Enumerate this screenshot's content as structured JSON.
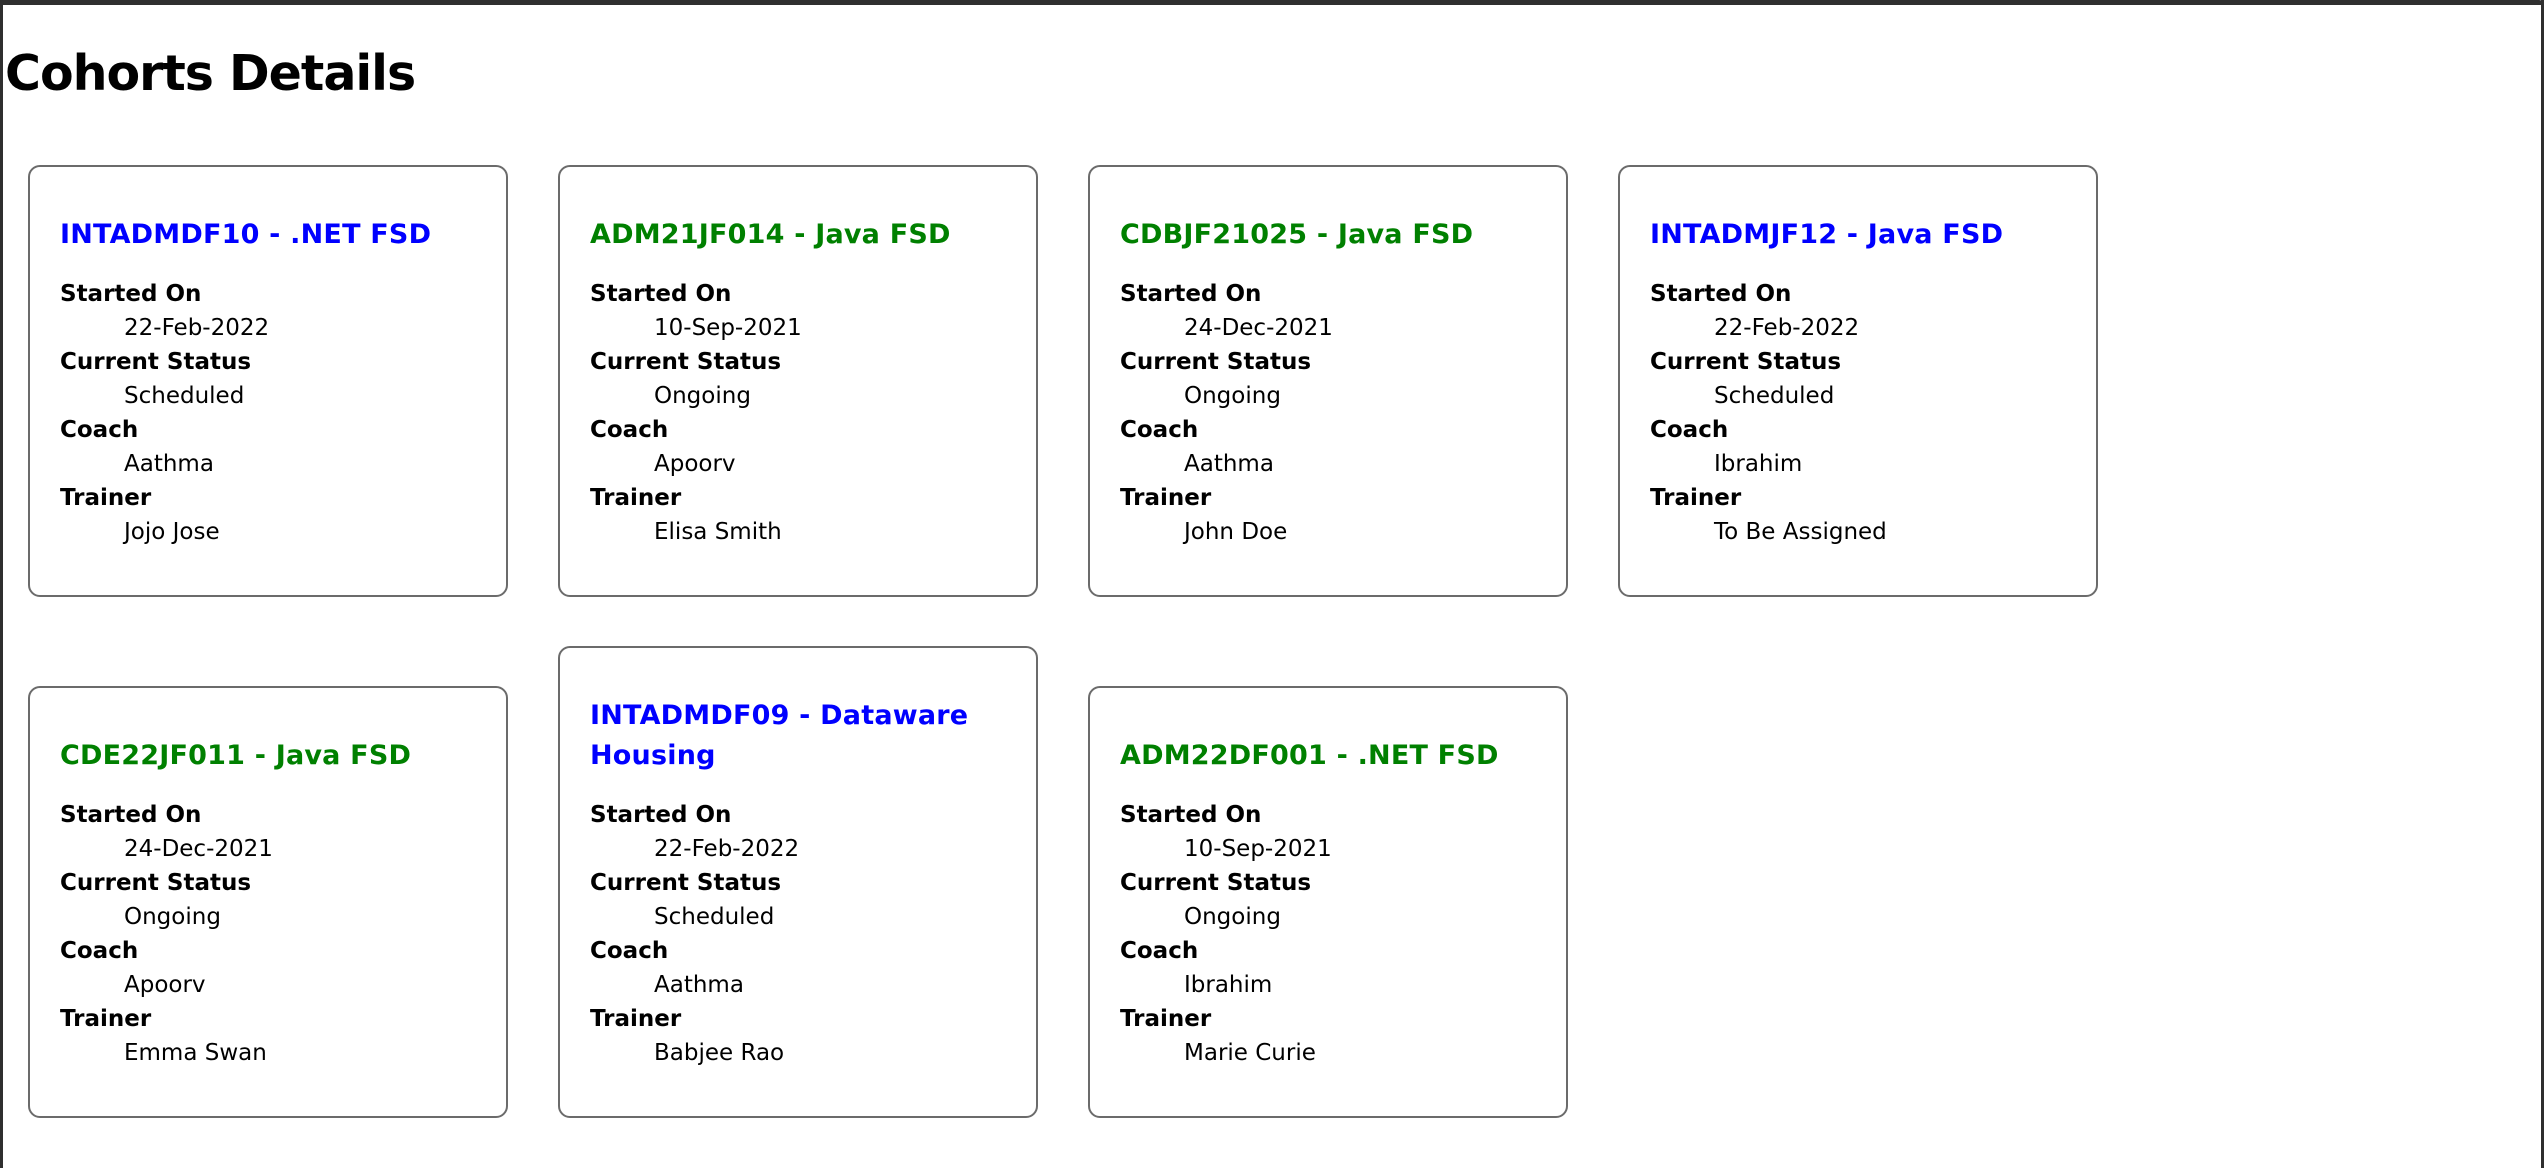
{
  "page": {
    "title": "Cohorts Details"
  },
  "colors": {
    "ongoing_title": "#008000",
    "scheduled_title": "#0000ff",
    "card_border": "#6b6b6b",
    "window_frame": "#2f2f2f"
  },
  "labels": {
    "started_on": "Started On",
    "current_status": "Current Status",
    "coach": "Coach",
    "trainer": "Trainer"
  },
  "cohorts": [
    {
      "title": "INTADMDF10 - .NET FSD",
      "started_on": "22-Feb-2022",
      "current_status": "Scheduled",
      "coach": "Aathma",
      "trainer": "Jojo Jose",
      "title_color": "blue"
    },
    {
      "title": "ADM21JF014 - Java FSD",
      "started_on": "10-Sep-2021",
      "current_status": "Ongoing",
      "coach": "Apoorv",
      "trainer": "Elisa Smith",
      "title_color": "green"
    },
    {
      "title": "CDBJF21025 - Java FSD",
      "started_on": "24-Dec-2021",
      "current_status": "Ongoing",
      "coach": "Aathma",
      "trainer": "John Doe",
      "title_color": "green"
    },
    {
      "title": "INTADMJF12 - Java FSD",
      "started_on": "22-Feb-2022",
      "current_status": "Scheduled",
      "coach": "Ibrahim",
      "trainer": "To Be Assigned",
      "title_color": "blue"
    },
    {
      "title": "CDE22JF011 - Java FSD",
      "started_on": "24-Dec-2021",
      "current_status": "Ongoing",
      "coach": "Apoorv",
      "trainer": "Emma Swan",
      "title_color": "green"
    },
    {
      "title": "INTADMDF09 - Dataware Housing",
      "started_on": "22-Feb-2022",
      "current_status": "Scheduled",
      "coach": "Aathma",
      "trainer": "Babjee Rao",
      "title_color": "blue"
    },
    {
      "title": "ADM22DF001 - .NET FSD",
      "started_on": "10-Sep-2021",
      "current_status": "Ongoing",
      "coach": "Ibrahim",
      "trainer": "Marie Curie",
      "title_color": "green"
    }
  ]
}
